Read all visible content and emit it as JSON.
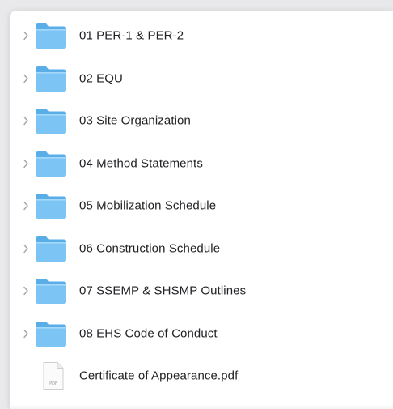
{
  "file_list": {
    "items": [
      {
        "name": "01 PER-1 & PER-2",
        "kind": "folder"
      },
      {
        "name": "02 EQU",
        "kind": "folder"
      },
      {
        "name": "03 Site Organization",
        "kind": "folder"
      },
      {
        "name": "04 Method Statements",
        "kind": "folder"
      },
      {
        "name": "05 Mobilization Schedule",
        "kind": "folder"
      },
      {
        "name": "06 Construction Schedule",
        "kind": "folder"
      },
      {
        "name": "07 SSEMP & SHSMP Outlines",
        "kind": "folder"
      },
      {
        "name": "08 EHS Code of Conduct",
        "kind": "folder"
      },
      {
        "name": "Certificate of Appearance.pdf",
        "kind": "pdf-file"
      }
    ],
    "pdf_badge": "PDF"
  },
  "colors": {
    "folder_front": "#7cc4f4",
    "folder_back": "#5aaee8",
    "chevron": "#a4a4a8",
    "text": "#222226"
  }
}
